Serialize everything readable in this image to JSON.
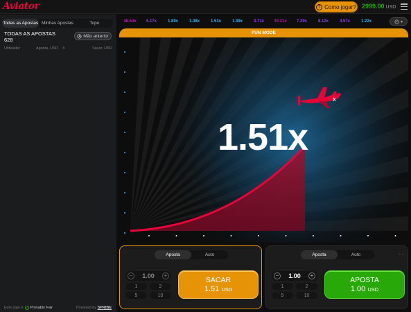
{
  "header": {
    "logo": "Aviator",
    "how_to_play": "Como jogar?",
    "balance": "2999.00",
    "currency": "USD"
  },
  "bets_panel": {
    "tabs": [
      {
        "label": "Todas as Apostas",
        "active": true
      },
      {
        "label": "Minhas Apostas",
        "active": false
      },
      {
        "label": "Topo",
        "active": false
      }
    ],
    "all_bets_title": "TODAS AS APOSTAS",
    "all_bets_count": "628",
    "previous_hand": "Mão anterior",
    "columns": {
      "user": "Utilizador",
      "bet": "Aposta, USD",
      "x": "X",
      "cashout": "Sacar, USD"
    }
  },
  "footer": {
    "game_is": "Este jogo é",
    "provably_fair": "Provably Fair",
    "powered_by": "Powered by",
    "brand": "SPRIBE"
  },
  "history": [
    {
      "value": "36.64x",
      "color": "#c017b4"
    },
    {
      "value": "5.17x",
      "color": "#913ef8"
    },
    {
      "value": "1.89x",
      "color": "#34b4ff"
    },
    {
      "value": "1.38x",
      "color": "#34b4ff"
    },
    {
      "value": "1.51x",
      "color": "#34b4ff"
    },
    {
      "value": "1.39x",
      "color": "#34b4ff"
    },
    {
      "value": "3.71x",
      "color": "#913ef8"
    },
    {
      "value": "10.21x",
      "color": "#c017b4"
    },
    {
      "value": "7.29x",
      "color": "#913ef8"
    },
    {
      "value": "8.12x",
      "color": "#913ef8"
    },
    {
      "value": "4.57x",
      "color": "#913ef8"
    },
    {
      "value": "1.22x",
      "color": "#34b4ff"
    }
  ],
  "game": {
    "mode_banner": "FUN MODE",
    "multiplier": "1.51x",
    "curve_color": "#e50539",
    "background_glow": "#1d6b9c"
  },
  "bet_panels": [
    {
      "tabs": [
        {
          "label": "Aposta",
          "active": true
        },
        {
          "label": "Auto",
          "active": false
        }
      ],
      "stake": "1.00",
      "quick_bets": [
        "1",
        "2",
        "5",
        "10"
      ],
      "button_label": "SACAR",
      "button_amount": "1.51",
      "button_currency": "USD",
      "button_color": "#e69308"
    },
    {
      "tabs": [
        {
          "label": "Aposta",
          "active": true
        },
        {
          "label": "Auto",
          "active": false
        }
      ],
      "stake": "1.00",
      "quick_bets": [
        "1",
        "2",
        "5",
        "10"
      ],
      "button_label": "APOSTA",
      "button_amount": "1.00",
      "button_currency": "USD",
      "button_color": "#28a909"
    }
  ]
}
